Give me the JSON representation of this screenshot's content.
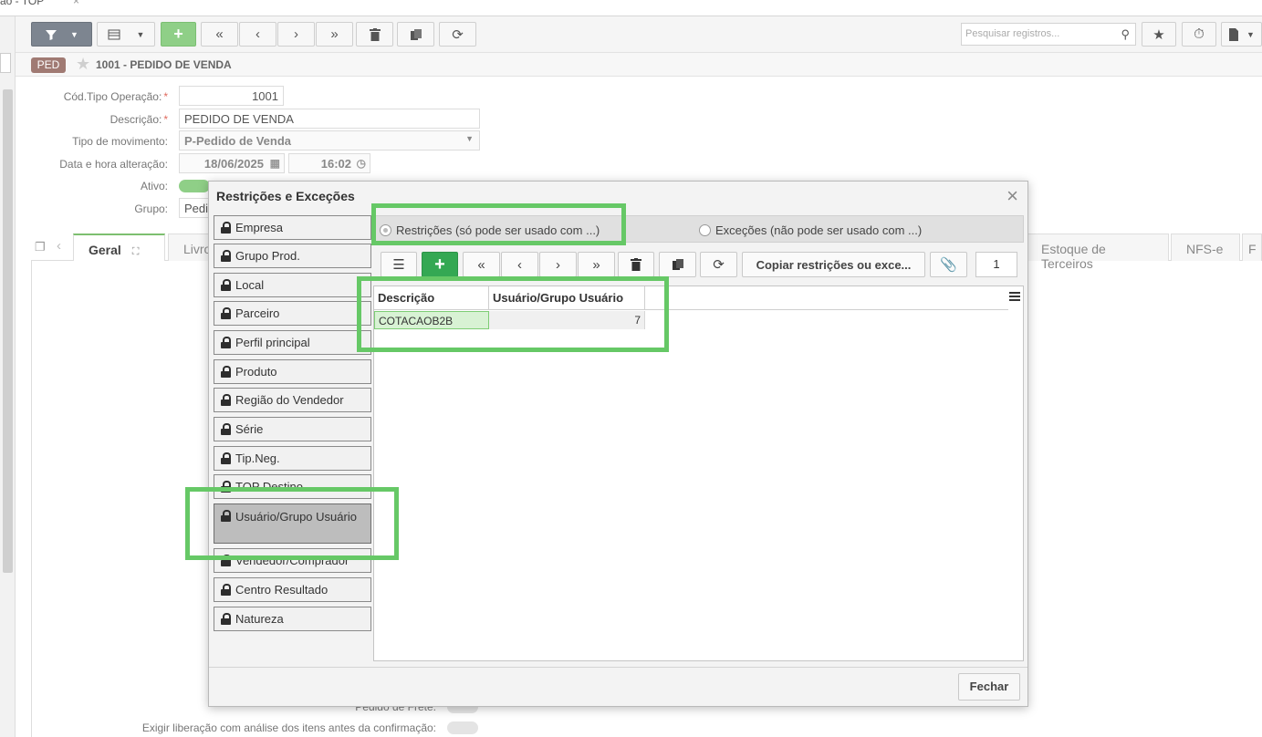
{
  "top_tab": {
    "label": "ão - TOP",
    "close": "×"
  },
  "toolbar": {
    "search_placeholder": "Pesquisar registros..."
  },
  "header": {
    "badge": "PED",
    "title": "1001 - PEDIDO DE VENDA"
  },
  "form": {
    "cod_tipo_label": "Cód.Tipo Operação:",
    "cod_tipo_value": "1001",
    "descricao_label": "Descrição:",
    "descricao_value": "PEDIDO DE VENDA",
    "tipo_mov_label": "Tipo de movimento:",
    "tipo_mov_value": "P-Pedido de Venda",
    "data_label": "Data e hora alteração:",
    "data_value": "18/06/2025",
    "hora_value": "16:02",
    "ativo_label": "Ativo:",
    "grupo_label": "Grupo:",
    "grupo_value": "Pedi",
    "required_mark": "*"
  },
  "tabs": {
    "geral": "Geral",
    "livro": "Livro",
    "estoque_terceiros": "Estoque de Terceiros",
    "nfse": "NFS-e",
    "f": "F"
  },
  "bottom": {
    "pedido_frete_label": "Pedido de Frete:",
    "exigir_label": "Exigir liberação com análise dos itens antes da confirmação:"
  },
  "modal": {
    "title": "Restrições e Exceções",
    "close": "×",
    "side_items": [
      {
        "label": "Empresa"
      },
      {
        "label": "Grupo Prod."
      },
      {
        "label": "Local"
      },
      {
        "label": "Parceiro"
      },
      {
        "label": "Perfil principal"
      },
      {
        "label": "Produto"
      },
      {
        "label": "Região do Vendedor"
      },
      {
        "label": "Série"
      },
      {
        "label": "Tip.Neg."
      },
      {
        "label": "TOP Destino"
      },
      {
        "label": "Usuário/Grupo Usuário"
      },
      {
        "label": "Vendedor/Comprador"
      },
      {
        "label": "Centro Resultado"
      },
      {
        "label": "Natureza"
      }
    ],
    "radio_restricoes": "Restrições (só pode ser usado com ...)",
    "radio_excecoes": "Exceções (não pode ser usado com ...)",
    "copy_button": "Copiar restrições ou exce...",
    "page_number": "1",
    "grid": {
      "columns": [
        "Descrição",
        "Usuário/Grupo Usuário"
      ],
      "rows": [
        {
          "descricao": "COTACAOB2B",
          "usuario": "7"
        }
      ]
    },
    "fechar": "Fechar"
  },
  "colors": {
    "highlight": "#66c866",
    "badge": "#a07a73",
    "add_green": "#34a853"
  }
}
